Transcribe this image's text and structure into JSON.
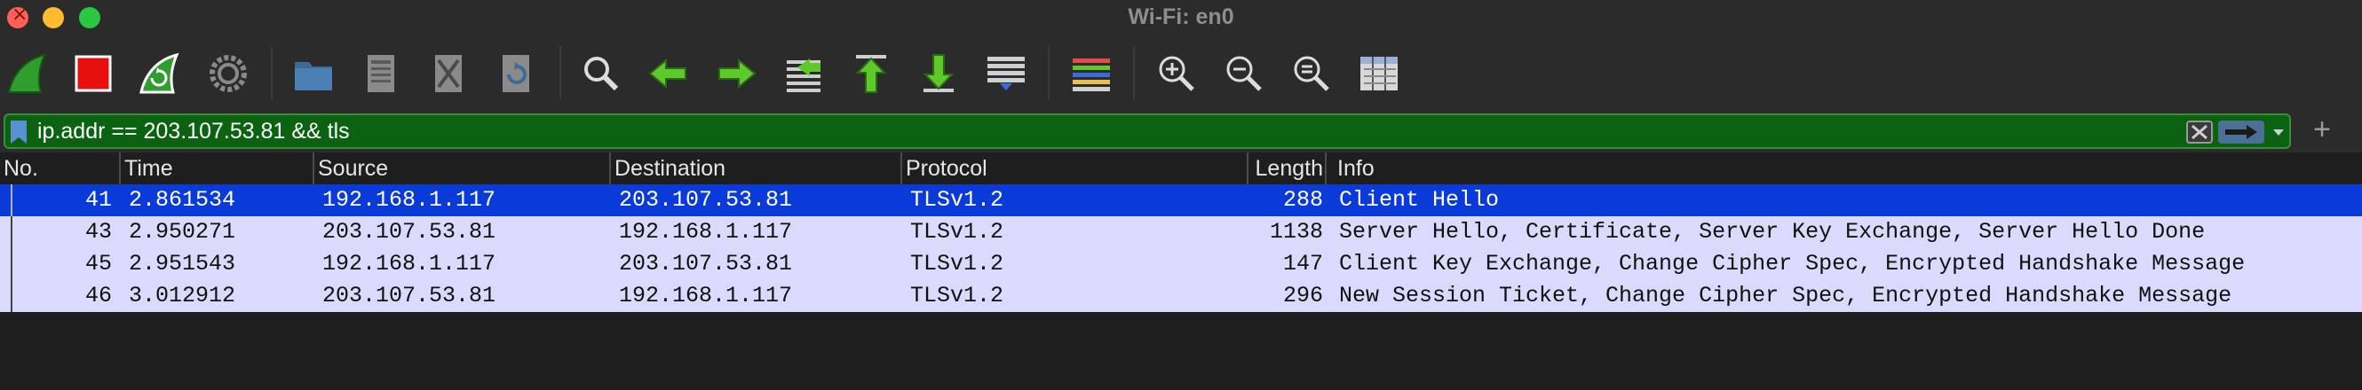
{
  "window": {
    "title": "Wi-Fi: en0"
  },
  "toolbar": {
    "buttons": [
      "start-capture-icon",
      "stop-capture-icon",
      "restart-capture-icon",
      "capture-options-icon",
      "open-file-icon",
      "save-file-icon",
      "close-file-icon",
      "reload-file-icon",
      "find-packet-icon",
      "go-back-icon",
      "go-forward-icon",
      "go-to-packet-icon",
      "go-first-icon",
      "go-last-icon",
      "auto-scroll-icon",
      "colorize-icon",
      "zoom-in-icon",
      "zoom-out-icon",
      "zoom-normal-icon",
      "resize-columns-icon"
    ]
  },
  "filter": {
    "value": "ip.addr == 203.107.53.81 && tls"
  },
  "columns": [
    "No.",
    "Time",
    "Source",
    "Destination",
    "Protocol",
    "Length",
    "Info"
  ],
  "packets": [
    {
      "no": "41",
      "time": "2.861534",
      "source": "192.168.1.117",
      "destination": "203.107.53.81",
      "protocol": "TLSv1.2",
      "length": "288",
      "info": "Client Hello",
      "selected": true
    },
    {
      "no": "43",
      "time": "2.950271",
      "source": "203.107.53.81",
      "destination": "192.168.1.117",
      "protocol": "TLSv1.2",
      "length": "1138",
      "info": "Server Hello, Certificate, Server Key Exchange, Server Hello Done",
      "selected": false
    },
    {
      "no": "45",
      "time": "2.951543",
      "source": "192.168.1.117",
      "destination": "203.107.53.81",
      "protocol": "TLSv1.2",
      "length": "147",
      "info": "Client Key Exchange, Change Cipher Spec, Encrypted Handshake Message",
      "selected": false
    },
    {
      "no": "46",
      "time": "3.012912",
      "source": "203.107.53.81",
      "destination": "192.168.1.117",
      "protocol": "TLSv1.2",
      "length": "296",
      "info": "New Session Ticket, Change Cipher Spec, Encrypted Handshake Message",
      "selected": false
    }
  ],
  "colors": {
    "selected_row": "#0a3ad7",
    "tls_row": "#dadafc",
    "filter_valid": "#0b6311"
  }
}
